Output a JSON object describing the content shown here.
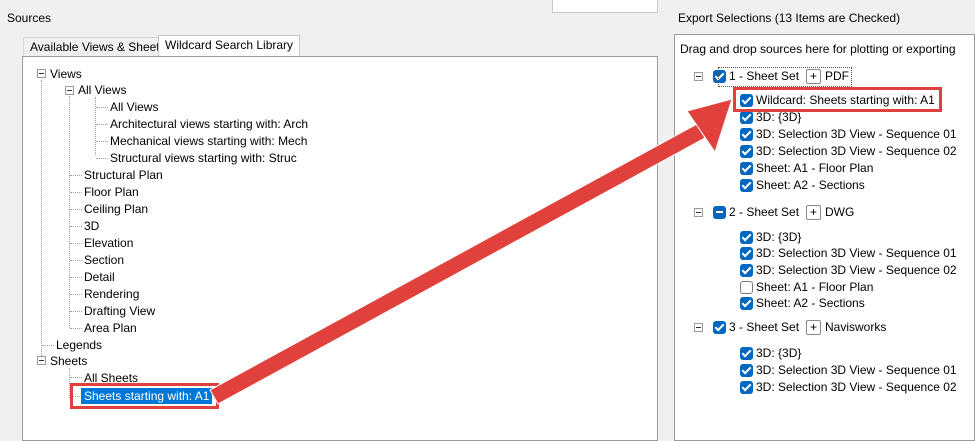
{
  "sources": {
    "title": "Sources",
    "tabs": [
      {
        "label": "Available Views & Sheets"
      },
      {
        "label": "Wildcard Search Library"
      }
    ],
    "tree": {
      "views": "Views",
      "all_views_group": "All Views",
      "all_views": "All Views",
      "arch": "Architectural views starting with: Arch",
      "mech": "Mechanical views starting with: Mech",
      "struc": "Structural views starting with: Struc",
      "structural_plan": "Structural Plan",
      "floor_plan": "Floor Plan",
      "ceiling_plan": "Ceiling Plan",
      "three_d": "3D",
      "elevation": "Elevation",
      "section": "Section",
      "detail": "Detail",
      "rendering": "Rendering",
      "drafting_view": "Drafting View",
      "area_plan": "Area Plan",
      "legends": "Legends",
      "sheets": "Sheets",
      "all_sheets": "All Sheets",
      "sheets_a1": "Sheets starting with: A1"
    }
  },
  "export": {
    "title": "Export Selections (13 Items are Checked)",
    "hint": "Drag and drop sources here for plotting or exporting",
    "sets": [
      {
        "name": "1 - Sheet Set",
        "format": "PDF",
        "state": "checked",
        "items": [
          {
            "label": "Wildcard: Sheets starting with: A1",
            "checked": true
          },
          {
            "label": "3D: {3D}",
            "checked": true
          },
          {
            "label": "3D: Selection 3D View - Sequence 01",
            "checked": true
          },
          {
            "label": "3D: Selection 3D View - Sequence 02",
            "checked": true
          },
          {
            "label": "Sheet: A1 - Floor Plan",
            "checked": true
          },
          {
            "label": "Sheet: A2 - Sections",
            "checked": true
          }
        ]
      },
      {
        "name": "2 - Sheet Set",
        "format": "DWG",
        "state": "partial",
        "items": [
          {
            "label": "3D: {3D}",
            "checked": true
          },
          {
            "label": "3D: Selection 3D View - Sequence 01",
            "checked": true
          },
          {
            "label": "3D: Selection 3D View - Sequence 02",
            "checked": true
          },
          {
            "label": "Sheet: A1 - Floor Plan",
            "checked": false
          },
          {
            "label": "Sheet: A2 - Sections",
            "checked": true
          }
        ]
      },
      {
        "name": "3 - Sheet Set",
        "format": "Navisworks",
        "state": "checked",
        "items": [
          {
            "label": "3D: {3D}",
            "checked": true
          },
          {
            "label": "3D: Selection 3D View - Sequence 01",
            "checked": true
          },
          {
            "label": "3D: Selection 3D View - Sequence 02",
            "checked": true
          }
        ]
      }
    ]
  },
  "colors": {
    "accent": "#0067c0",
    "highlight": "#e0413c",
    "selection": "#0078d7"
  }
}
